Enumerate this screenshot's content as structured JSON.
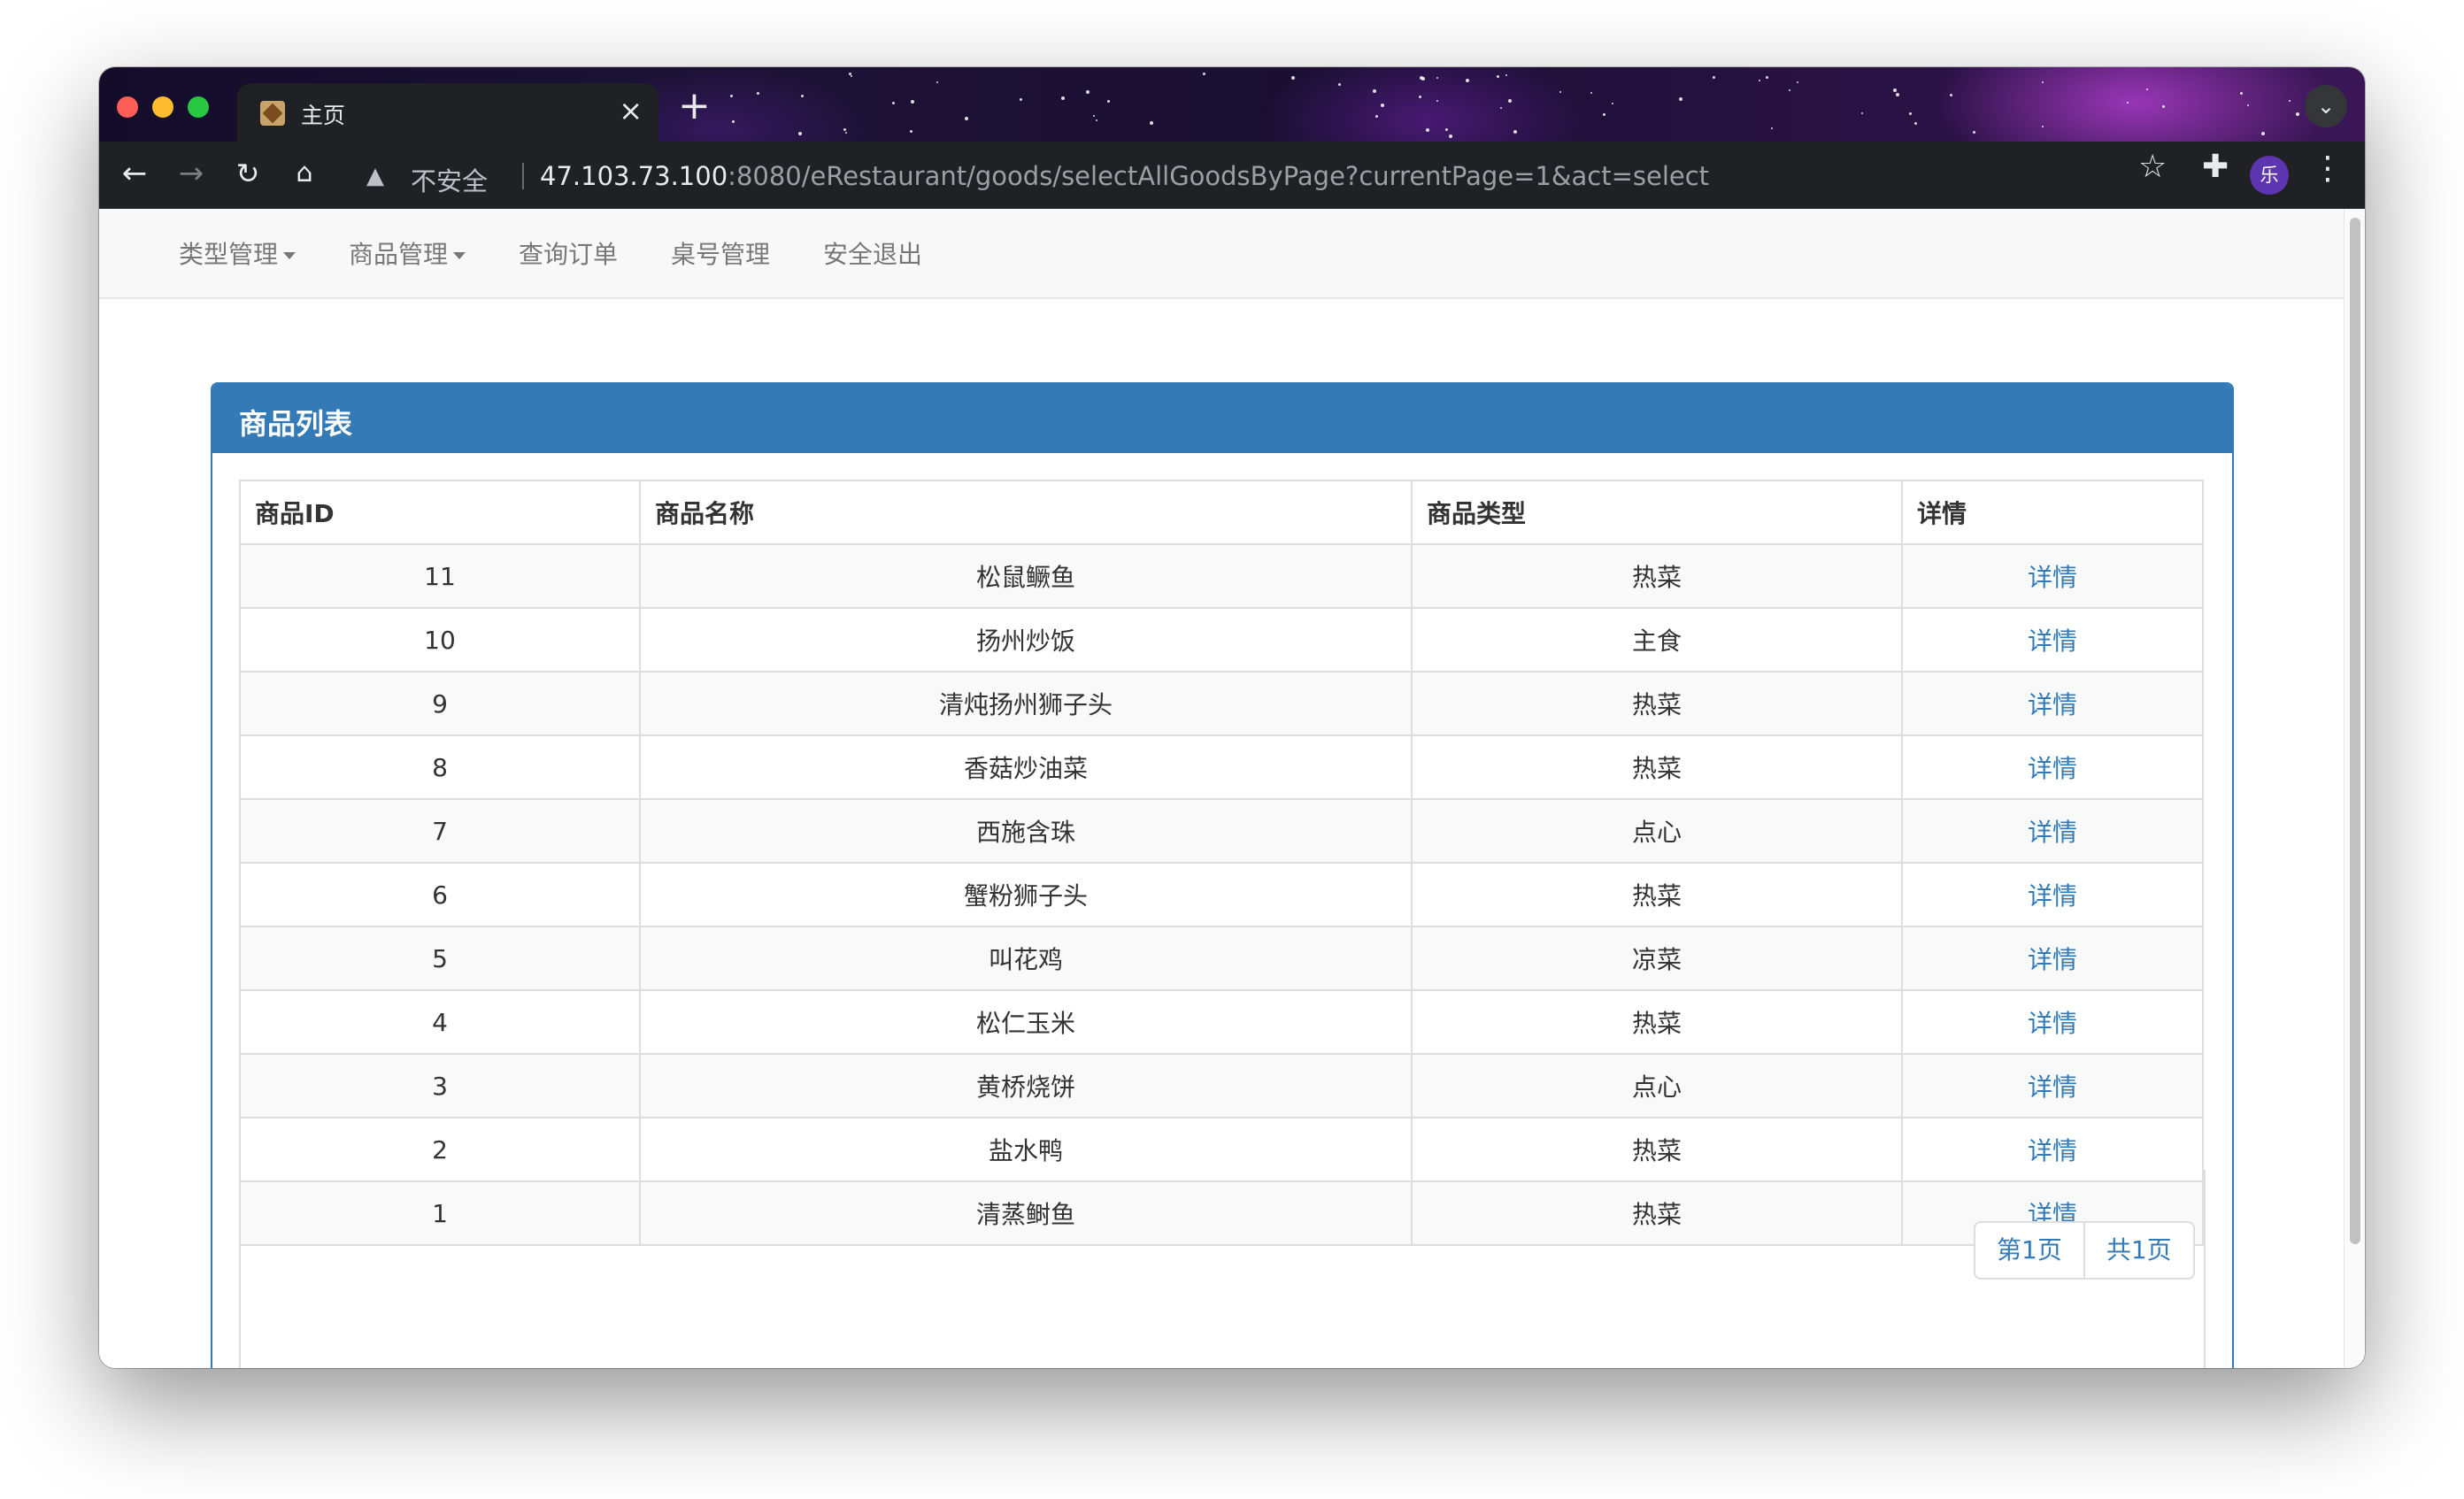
{
  "browser": {
    "tab_title": "主页",
    "insecure_label": "不安全",
    "url_host": "47.103.73.100",
    "url_rest": ":8080/eRestaurant/goods/selectAllGoodsByPage?currentPage=1&act=select",
    "avatar_letter": "乐",
    "icons": {
      "back": "back-arrow-icon",
      "forward": "forward-arrow-icon",
      "reload": "reload-icon",
      "home": "home-icon",
      "warning": "warning-icon",
      "bookmark": "star-icon",
      "extensions": "puzzle-icon",
      "menu": "more-vertical-icon"
    }
  },
  "navbar": {
    "items": [
      {
        "label": "类型管理",
        "dropdown": true
      },
      {
        "label": "商品管理",
        "dropdown": true
      },
      {
        "label": "查询订单",
        "dropdown": false
      },
      {
        "label": "桌号管理",
        "dropdown": false
      },
      {
        "label": "安全退出",
        "dropdown": false
      }
    ]
  },
  "panel": {
    "title": "商品列表",
    "accent_color": "#337ab7"
  },
  "table": {
    "headers": [
      "商品ID",
      "商品名称",
      "商品类型",
      "详情"
    ],
    "rows": [
      {
        "id": "11",
        "name": "松鼠鳜鱼",
        "type": "热菜",
        "detail": "详情"
      },
      {
        "id": "10",
        "name": "扬州炒饭",
        "type": "主食",
        "detail": "详情"
      },
      {
        "id": "9",
        "name": "清炖扬州狮子头",
        "type": "热菜",
        "detail": "详情"
      },
      {
        "id": "8",
        "name": "香菇炒油菜",
        "type": "热菜",
        "detail": "详情"
      },
      {
        "id": "7",
        "name": "西施含珠",
        "type": "点心",
        "detail": "详情"
      },
      {
        "id": "6",
        "name": "蟹粉狮子头",
        "type": "热菜",
        "detail": "详情"
      },
      {
        "id": "5",
        "name": "叫花鸡",
        "type": "凉菜",
        "detail": "详情"
      },
      {
        "id": "4",
        "name": "松仁玉米",
        "type": "热菜",
        "detail": "详情"
      },
      {
        "id": "3",
        "name": "黄桥烧饼",
        "type": "点心",
        "detail": "详情"
      },
      {
        "id": "2",
        "name": "盐水鸭",
        "type": "热菜",
        "detail": "详情"
      },
      {
        "id": "1",
        "name": "清蒸鲥鱼",
        "type": "热菜",
        "detail": "详情"
      }
    ]
  },
  "pagination": {
    "current": "第1页",
    "total": "共1页"
  }
}
